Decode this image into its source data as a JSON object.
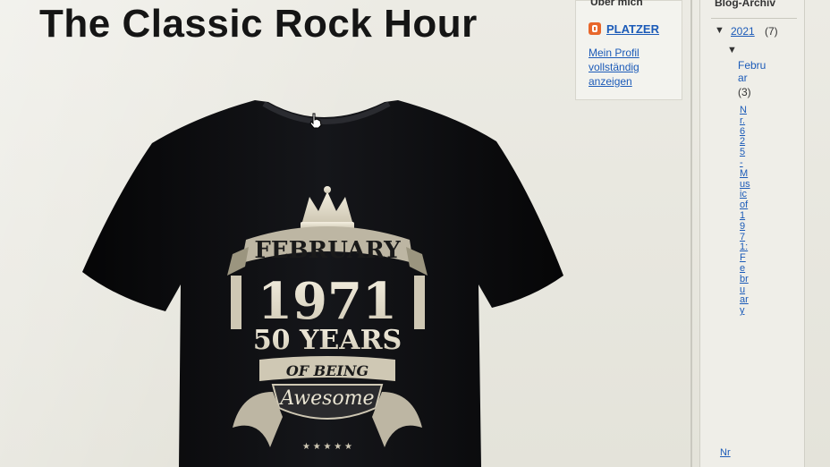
{
  "header": {
    "title": "The Classic Rock Hour"
  },
  "about": {
    "title": "Über mich",
    "profile_name": "PLATZER",
    "profile_link": "Mein Profil vollständig anzeigen",
    "icon": "blogger-icon"
  },
  "archive": {
    "title": "Blog-Archiv",
    "year_label": "2021",
    "year_count": "(7)",
    "month_label": "Februar",
    "month_count": "(3)",
    "post_link": "Nr. 625 - Music of 1971: February",
    "post_link_2": "Nr"
  },
  "shirt": {
    "month": "FEBRUARY",
    "year": "1971",
    "years_text": "50 YEARS",
    "of_being": "OF BEING",
    "script_word": "Awesome"
  },
  "colors": {
    "link": "#1c5bb8",
    "shirt": "#0d0d0f",
    "print": "#e9e4d2",
    "blogger_orange": "#e8672b"
  }
}
